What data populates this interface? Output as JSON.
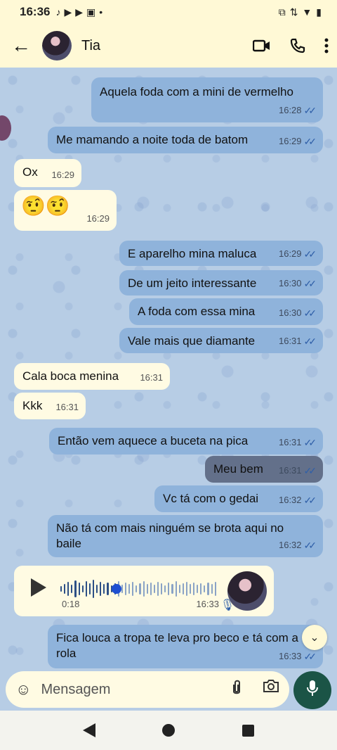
{
  "status": {
    "time": "16:36",
    "left_icons": [
      "tiktok-icon",
      "youtube-icon",
      "youtube-icon",
      "app-icon",
      "dot-icon"
    ],
    "right_icons": [
      "cast-icon",
      "data-icon",
      "wifi-icon",
      "battery-icon"
    ]
  },
  "header": {
    "back": "←",
    "contact_name": "Tia",
    "video_icon": "video-call-icon",
    "phone_icon": "phone-icon",
    "menu_icon": "more-icon"
  },
  "messages": [
    {
      "text": "Aquela foda com a mini de vermelho",
      "time": "16:28",
      "dir": "out"
    },
    {
      "text": "Me mamando a noite toda de batom",
      "time": "16:29",
      "dir": "out"
    },
    {
      "text": "Ox",
      "time": "16:29",
      "dir": "in"
    },
    {
      "text": "🤨🤨",
      "time": "16:29",
      "dir": "in"
    },
    {
      "text": "E aparelho  mina maluca",
      "time": "16:29",
      "dir": "out"
    },
    {
      "text": "De um jeito interessante",
      "time": "16:30",
      "dir": "out"
    },
    {
      "text": "A foda com essa mina",
      "time": "16:30",
      "dir": "out"
    },
    {
      "text": "Vale mais que diamante",
      "time": "16:31",
      "dir": "out"
    },
    {
      "text": "Cala boca menina",
      "time": "16:31",
      "dir": "in"
    },
    {
      "text": "Kkk",
      "time": "16:31",
      "dir": "in"
    },
    {
      "text": "Então vem aquece a buceta  na pica",
      "time": "16:31",
      "dir": "out"
    },
    {
      "text": "Meu bem",
      "time": "16:31",
      "dir": "out"
    },
    {
      "text": "Vc tá com o gedai",
      "time": "16:32",
      "dir": "out"
    },
    {
      "text": "Não tá com mais ninguém se brota aqui no baile",
      "time": "16:32",
      "dir": "out"
    },
    {
      "text": "Fica louca a tropa te leva pro beco e tá com a rola",
      "time": "16:33",
      "dir": "out"
    }
  ],
  "audio": {
    "duration": "0:18",
    "time": "16:33",
    "progress": 0.36
  },
  "composer": {
    "placeholder": "Mensagem"
  },
  "ticks": "✓✓"
}
